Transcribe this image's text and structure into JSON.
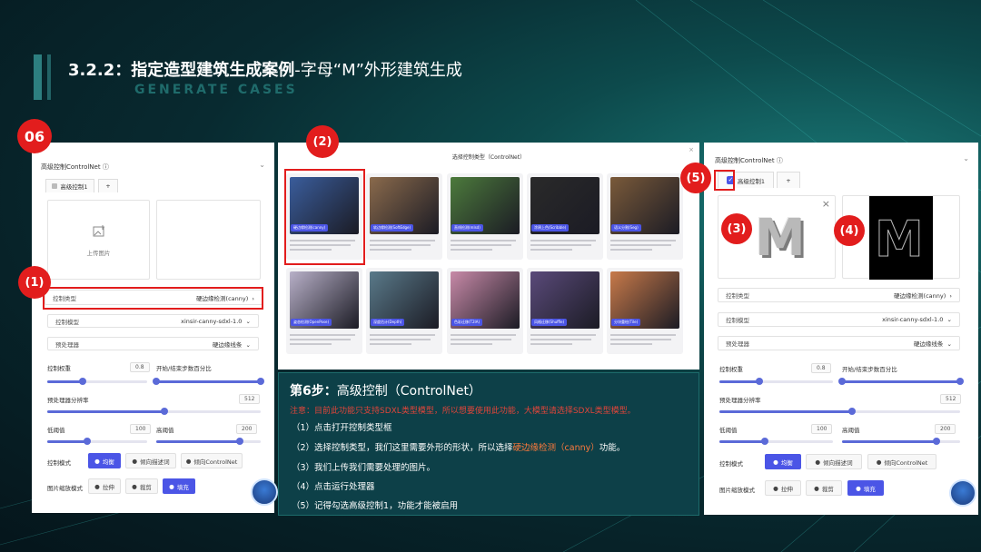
{
  "header": {
    "title_bold": "3.2.2：指定造型建筑生成案例",
    "title_rest": "-字母“M”外形建筑生成",
    "subtitle": "GENERATE CASES"
  },
  "badges": {
    "step_number": "06",
    "b1": "(1)",
    "b2": "(2)",
    "b3": "(3)",
    "b4": "(4)",
    "b5": "(5)"
  },
  "left_panel": {
    "section_title": "高级控制ControlNet",
    "tab_label": "高级控制1",
    "tab_add": "+",
    "upload_label": "上传图片",
    "control_type_label": "控制类型",
    "control_type_value": "硬边缘检测(canny)",
    "model_label": "控制模型",
    "model_value": "xinsir-canny-sdxl-1.0",
    "preprocessor_label": "预处理器",
    "preprocessor_value": "硬边缘线条",
    "weight_label": "控制权重",
    "weight_value": "0.8",
    "start_end_label": "开始/结束步数百分比",
    "resolution_label": "预处理器分辨率",
    "resolution_value": "512",
    "low_label": "低阈值",
    "low_value": "100",
    "high_label": "高阈值",
    "high_value": "200",
    "mode_label": "控制模式",
    "mode_options": [
      "均衡",
      "倾向描述词",
      "倾向ControlNet"
    ],
    "scale_label": "图片缩放模式",
    "scale_options": [
      "拉伸",
      "裁剪",
      "填充"
    ],
    "weight_fraction": 0.35,
    "start_fraction": 0.0,
    "end_fraction": 1.0,
    "resolution_fraction": 0.55,
    "low_fraction": 0.4,
    "high_fraction": 0.8
  },
  "modal": {
    "title": "选择控制类型（ControlNet）",
    "close": "×",
    "cards": [
      {
        "caption": "硬边缘检测(canny)",
        "color": "#3a5d9c"
      },
      {
        "caption": "软边缘检测(SoftEdge)",
        "color": "#8a6a4c"
      },
      {
        "caption": "直线检测(mlsd)",
        "color": "#4c7a3c"
      },
      {
        "caption": "涂鸦上色(Scribble)",
        "color": "#2a2a2a"
      },
      {
        "caption": "语义分割(Seg)",
        "color": "#7a5a3a"
      },
      {
        "caption": "姿态检测(OpenPose)",
        "color": "#b8b0c8"
      },
      {
        "caption": "深度估计(Depth)",
        "color": "#5a7a8a"
      },
      {
        "caption": "色彩迁移(T2IA)",
        "color": "#c88aa8"
      },
      {
        "caption": "风格迁移(Shuffle)",
        "color": "#5a4a7a"
      },
      {
        "caption": "分块重绘(Tile)",
        "color": "#c87a4a"
      }
    ]
  },
  "instructions": {
    "step_label": "第6步：",
    "step_title": "高级控制（ControlNet）",
    "note": "注意：目前此功能只支持SDXL类型模型，所以想要使用此功能，大模型请选择SDXL类型模型。",
    "line1": "（1）点击打开控制类型框",
    "line2_a": "（2）选择控制类型，我们这里需要外形的形状，所以选择",
    "line2_hl": "硬边缘检测（canny）",
    "line2_b": "功能。",
    "line3": "（3）我们上传我们需要处理的图片。",
    "line4": "（4）点击运行处理器",
    "line5": "（5）记得勾选高级控制1，功能才能被启用"
  },
  "right_panel": {
    "section_title": "高级控制ControlNet",
    "tab_label": "高级控制1",
    "tab_add": "+",
    "close_icon": "×",
    "image_letter": "M",
    "control_type_label": "控制类型",
    "control_type_value": "硬边缘检测(canny)",
    "model_label": "控制模型",
    "model_value": "xinsir-canny-sdxl-1.0",
    "preprocessor_label": "预处理器",
    "preprocessor_value": "硬边缘线条",
    "weight_label": "控制权重",
    "weight_value": "0.8",
    "start_end_label": "开始/结束步数百分比",
    "resolution_label": "预处理器分辨率",
    "resolution_value": "512",
    "low_label": "低阈值",
    "low_value": "100",
    "high_label": "高阈值",
    "high_value": "200",
    "mode_label": "控制模式",
    "mode_options": [
      "均衡",
      "倾向描述词",
      "倾向ControlNet"
    ],
    "scale_label": "图片缩放模式",
    "scale_options": [
      "拉伸",
      "裁剪",
      "填充"
    ],
    "checked": true
  },
  "colors": {
    "accent": "#4b55e6",
    "highlight": "#e21d1d"
  }
}
